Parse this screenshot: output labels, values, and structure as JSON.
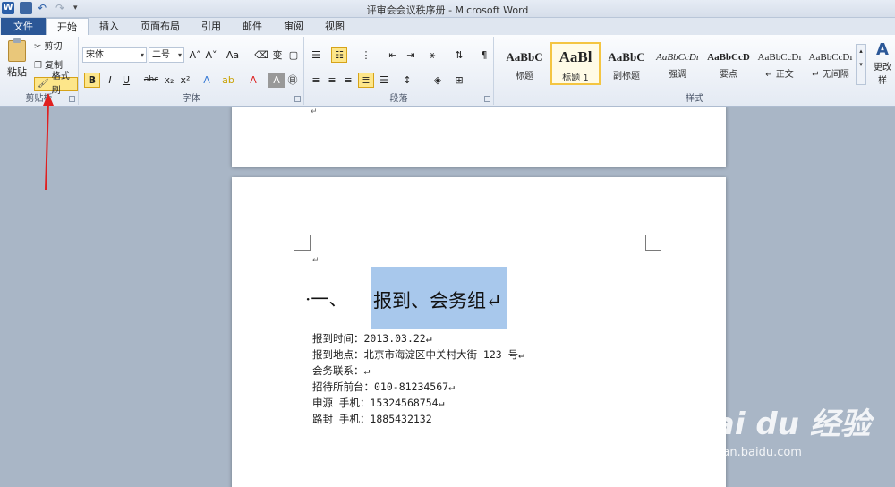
{
  "app": {
    "title": "评审会会议秩序册 - Microsoft Word",
    "qat": {
      "logo": "W",
      "undo": "↶",
      "redo": "↷",
      "more": "▾"
    }
  },
  "tabs": [
    "文件",
    "开始",
    "插入",
    "页面布局",
    "引用",
    "邮件",
    "审阅",
    "视图"
  ],
  "clipboard": {
    "paste": "粘贴",
    "cut": "剪切",
    "copy": "复制",
    "format_painter": "格式刷",
    "label": "剪贴板"
  },
  "font": {
    "font_name": "宋体",
    "font_size": "二号",
    "grow": "A˄",
    "shrink": "A˅",
    "case": "Aa",
    "bold": "B",
    "italic": "I",
    "underline": "U",
    "strike": "abc",
    "subscript": "x₂",
    "superscript": "x²",
    "label": "字体"
  },
  "paragraph": {
    "label": "段落"
  },
  "styles": {
    "items": [
      {
        "sample": "AaBbC",
        "name": "标题"
      },
      {
        "sample": "AaBl",
        "name": "标题 1"
      },
      {
        "sample": "AaBbC",
        "name": "副标题"
      },
      {
        "sample": "AaBbCcDı",
        "name": "强调"
      },
      {
        "sample": "AaBbCcD",
        "name": "要点"
      },
      {
        "sample": "AaBbCcDı",
        "name": "↵ 正文"
      },
      {
        "sample": "AaBbCcDı",
        "name": "↵ 无间隔"
      }
    ],
    "change_styles": "更改样",
    "label": "样式"
  },
  "document": {
    "heading_number": "·一、",
    "heading_text": "报到、会务组↵",
    "lines": [
      "报到时间：2013.03.22↵",
      "报到地点：北京市海淀区中关村大街 123 号↵",
      "会务联系：↵",
      "招待所前台：010-81234567↵",
      "申源  手机：15324568754↵",
      "路封  手机：1885432132"
    ],
    "pilcrow": "↵"
  },
  "watermark": {
    "title": "Bai du 经验",
    "url": "jingyan.baidu.com"
  },
  "colors": {
    "file_tab": "#2b5797",
    "selection": "#a8c8ec",
    "highlight_button": "#fde68a",
    "annotation_arrow": "#e02020"
  }
}
